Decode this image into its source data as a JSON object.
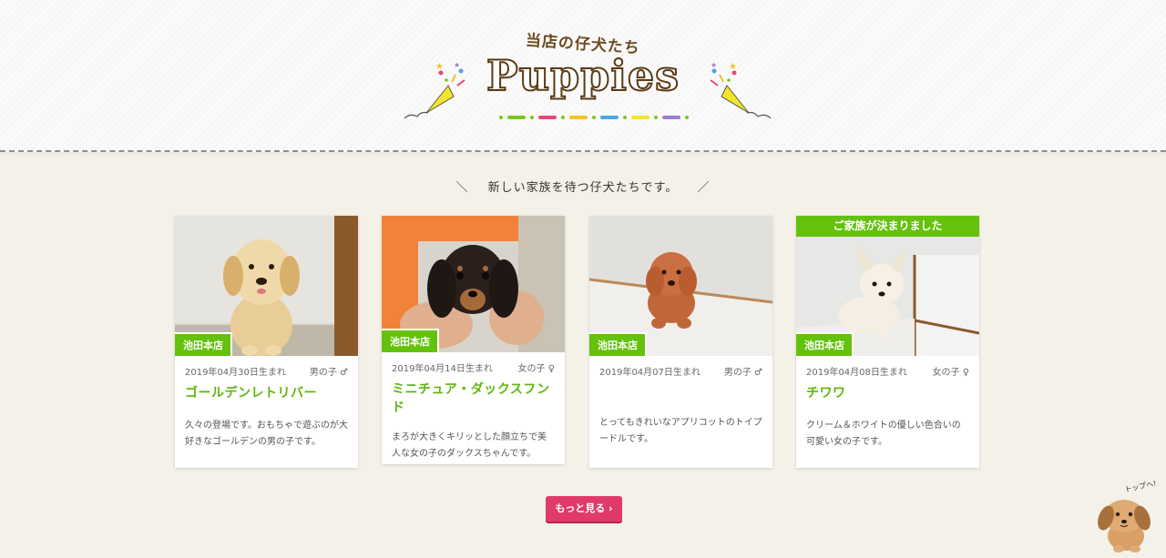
{
  "header": {
    "subtitle": "当店の仔犬たち",
    "title": "Puppies",
    "dot_colors": [
      "#7cc61b",
      "#e8467b",
      "#f2c22a",
      "#4aa8e0",
      "#f2e52a",
      "#9a7fc6"
    ]
  },
  "tagline": {
    "left_slash": "＼",
    "text": "新しい家族を待つ仔犬たちです。",
    "right_slash": "／"
  },
  "puppies": [
    {
      "ribbon": "",
      "shop": "池田本店",
      "birth": "2019年04月30日生まれ",
      "sex": "男の子 ♂",
      "name": "ゴールデンレトリバー",
      "description": "久々の登場です。おもちゃで遊ぶのが大好きなゴールデンの男の子です。"
    },
    {
      "ribbon": "",
      "shop": "池田本店",
      "birth": "2019年04月14日生まれ",
      "sex": "女の子 ♀",
      "name": "ミニチュア・ダックスフンド",
      "description": "まろが大きくキリッとした顔立ちで美人な女の子のダックスちゃんです。"
    },
    {
      "ribbon": "",
      "shop": "池田本店",
      "birth": "2019年04月07日生まれ",
      "sex": "男の子 ♂",
      "name": "",
      "description": "とってもきれいなアプリコットのトイプードルです。"
    },
    {
      "ribbon": "ご家族が決まりました",
      "shop": "池田本店",
      "birth": "2019年04月08日生まれ",
      "sex": "女の子 ♀",
      "name": "チワワ",
      "description": "クリーム＆ホワイトの優しい色合いの可愛い女の子です。"
    }
  ],
  "more_button": {
    "label": "もっと見る ›"
  },
  "to_top": {
    "label": "トップへ!"
  },
  "colors": {
    "accent_green": "#64c10c",
    "name_green": "#5fb70d",
    "button_pink": "#e03a6a"
  }
}
